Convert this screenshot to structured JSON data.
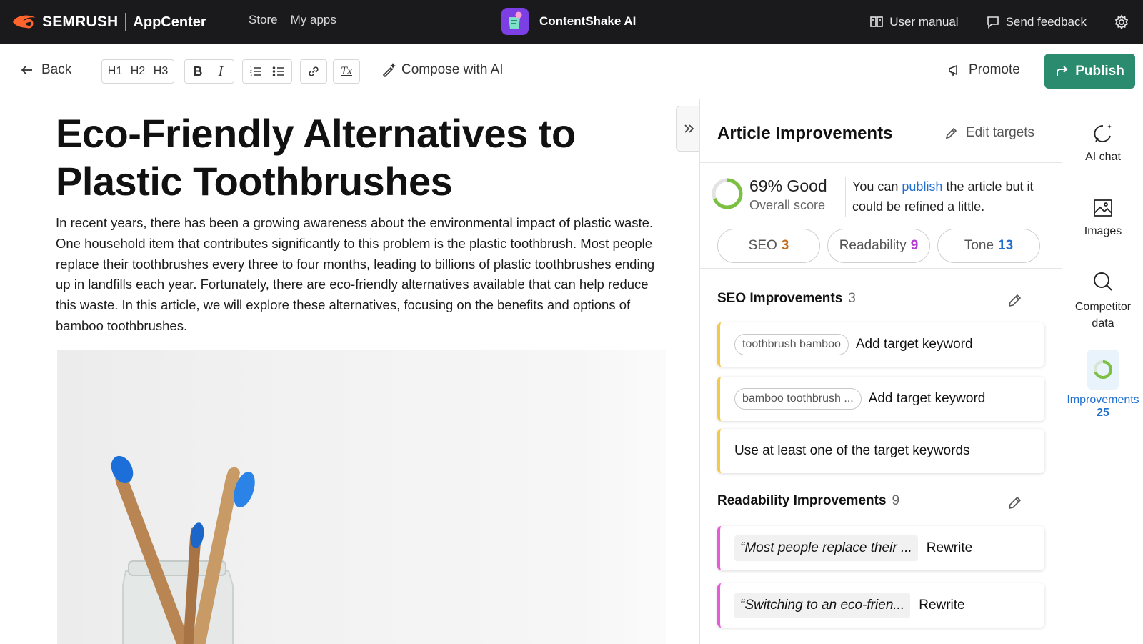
{
  "topbar": {
    "brand": "SEMRUSH",
    "app_center": "AppCenter",
    "nav": [
      "Store",
      "My apps"
    ],
    "app_name": "ContentShake AI",
    "user_manual": "User manual",
    "send_feedback": "Send feedback"
  },
  "toolbar": {
    "back": "Back",
    "headings": [
      "H1",
      "H2",
      "H3"
    ],
    "bold": "B",
    "italic": "I",
    "clear_format": "Tx",
    "compose": "Compose with AI",
    "promote": "Promote",
    "publish": "Publish"
  },
  "article": {
    "title": "Eco-Friendly Alternatives to Plastic Toothbrushes",
    "intro": "In recent years, there has been a growing awareness about the environmental impact of plastic waste. One household item that contributes significantly to this problem is the plastic toothbrush. Most people replace their toothbrushes every three to four months, leading to billions of plastic toothbrushes ending up in landfills each year. Fortunately, there are eco-friendly alternatives available that can help reduce this waste. In this article, we will explore these alternatives, focusing on the benefits and options of bamboo toothbrushes."
  },
  "panel": {
    "title": "Article Improvements",
    "edit_targets": "Edit targets",
    "score": {
      "value": "69% Good",
      "percent": 69,
      "label": "Overall score",
      "note_pre": "You can ",
      "note_link": "publish",
      "note_post": " the article but it could be refined a little."
    },
    "pills": [
      {
        "label": "SEO",
        "count": "3",
        "color": "#c46a1a"
      },
      {
        "label": "Readability",
        "count": "9",
        "color": "#b43fcf"
      },
      {
        "label": "Tone",
        "count": "13",
        "color": "#1f6fd1"
      }
    ],
    "seo": {
      "title": "SEO Improvements",
      "count": "3",
      "items": [
        {
          "chip": "toothbrush bamboo",
          "action": "Add target keyword"
        },
        {
          "chip": "bamboo toothbrush ...",
          "action": "Add target keyword"
        },
        {
          "chip": "",
          "action": "Use at least one of the target keywords"
        }
      ]
    },
    "readability": {
      "title": "Readability Improvements",
      "count": "9",
      "items": [
        {
          "quote": "“Most people replace their ...",
          "action": "Rewrite"
        },
        {
          "quote": "“Switching to an eco-frien...",
          "action": "Rewrite"
        }
      ]
    }
  },
  "rail": {
    "ai_chat": "AI chat",
    "images": "Images",
    "competitor": "Competitor data",
    "improvements": "Improvements",
    "improvements_count": "25"
  },
  "colors": {
    "accent": "#2b8b6e",
    "link": "#1f6fd1",
    "seo_bar": "#f3c94a",
    "readability_bar": "#e85bd8",
    "score_ring": "#7bc043"
  }
}
